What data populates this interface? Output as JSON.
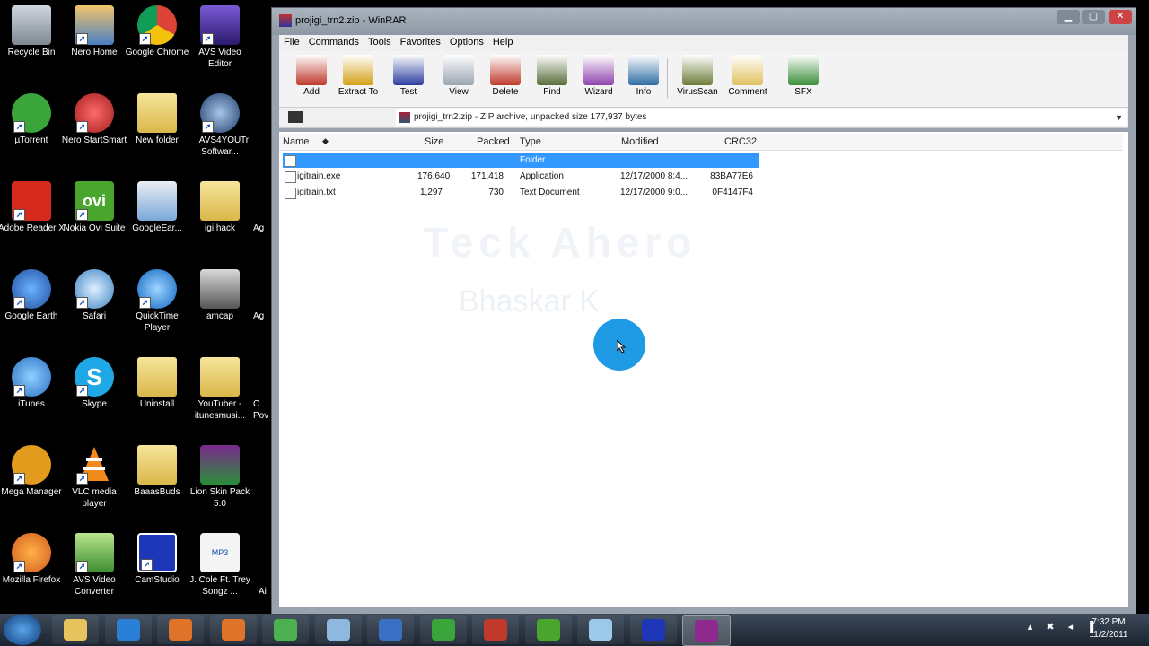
{
  "desktop": {
    "icons": [
      {
        "label": "Recycle Bin"
      },
      {
        "label": "Nero Home"
      },
      {
        "label": "Google Chrome"
      },
      {
        "label": "AVS Video Editor"
      },
      {
        "label": "µTorrent"
      },
      {
        "label": "Nero StartSmart"
      },
      {
        "label": "New folder"
      },
      {
        "label": "AVS4YOU Softwar..."
      },
      {
        "label": "Adobe Reader X"
      },
      {
        "label": "Nokia Ovi Suite"
      },
      {
        "label": "GoogleEar..."
      },
      {
        "label": "igi hack"
      },
      {
        "label": "Google Earth"
      },
      {
        "label": "Safari"
      },
      {
        "label": "QuickTime Player"
      },
      {
        "label": "amcap"
      },
      {
        "label": "iTunes"
      },
      {
        "label": "Skype"
      },
      {
        "label": "Uninstall"
      },
      {
        "label": "YouTuber - itunesmusi..."
      },
      {
        "label": "Mega Manager"
      },
      {
        "label": "VLC media player"
      },
      {
        "label": "BaaasBuds"
      },
      {
        "label": "Lion Skin Pack 5.0"
      },
      {
        "label": "Mozilla Firefox"
      },
      {
        "label": "AVS Video Converter"
      },
      {
        "label": "CamStudio"
      },
      {
        "label": "J. Cole Ft. Trey Songz ..."
      }
    ],
    "partial_labels": [
      "Tr",
      "Ag",
      "Ag",
      "C\nPov",
      "Ai"
    ]
  },
  "window": {
    "title": "projigi_trn2.zip - WinRAR",
    "menu": [
      "File",
      "Commands",
      "Tools",
      "Favorites",
      "Options",
      "Help"
    ],
    "toolbar": [
      {
        "label": "Add",
        "color": "#c0392b"
      },
      {
        "label": "Extract To",
        "color": "#d4a017"
      },
      {
        "label": "Test",
        "color": "#2c3e9e"
      },
      {
        "label": "View",
        "color": "#9aa5b1"
      },
      {
        "label": "Delete",
        "color": "#c0392b"
      },
      {
        "label": "Find",
        "color": "#5a6e3a"
      },
      {
        "label": "Wizard",
        "color": "#8e44ad"
      },
      {
        "label": "Info",
        "color": "#2e6da4"
      },
      {
        "label": "VirusScan",
        "color": "#6d7d3a"
      },
      {
        "label": "Comment",
        "color": "#e0c060"
      },
      {
        "label": "SFX",
        "color": "#3a8e3a"
      }
    ],
    "address": "projigi_trn2.zip - ZIP archive, unpacked size 177,937 bytes",
    "columns": [
      "Name",
      "Size",
      "Packed",
      "Type",
      "Modified",
      "CRC32"
    ],
    "files": [
      {
        "name": "..",
        "size": "",
        "packed": "",
        "type": "Folder",
        "modified": "",
        "crc": "",
        "selected": true
      },
      {
        "name": "igitrain.exe",
        "size": "176,640",
        "packed": "171,418",
        "type": "Application",
        "modified": "12/17/2000 8:4...",
        "crc": "83BA77E6",
        "selected": false
      },
      {
        "name": "igitrain.txt",
        "size": "1,297",
        "packed": "730",
        "type": "Text Document",
        "modified": "12/17/2000 9:0...",
        "crc": "0F4147F4",
        "selected": false
      }
    ],
    "watermark_line1": "Teck Ahero",
    "watermark_line2": "Bhaskar K"
  },
  "taskbar": {
    "tasks": [
      "Windows Explorer",
      "Internet Explorer",
      "Windows Media Player",
      "Mozilla Firefox",
      "Google Chrome",
      "Safari",
      "iTunes",
      "µTorrent",
      "Nero",
      "Nokia Ovi Suite",
      "Notepad",
      "CamStudio",
      "WinRAR"
    ],
    "time": "7:32 PM",
    "date": "11/2/2011"
  },
  "colors": {
    "selection": "#3399ff",
    "cursor_highlight": "#1f9ae5"
  }
}
